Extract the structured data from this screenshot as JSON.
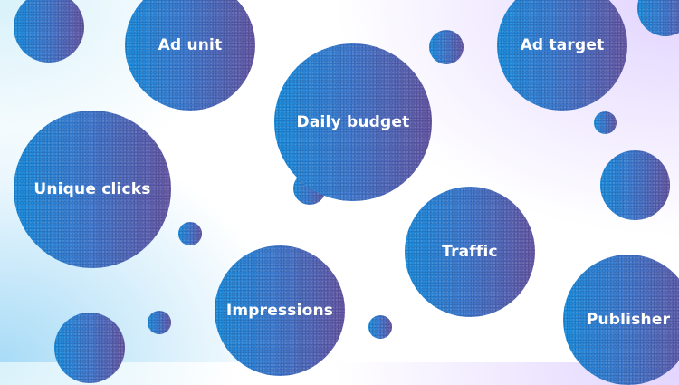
{
  "bubbles": {
    "ad_unit": "Ad unit",
    "ad_target": "Ad target",
    "daily_budget": "Daily budget",
    "unique_clicks": "Unique clicks",
    "traffic": "Traffic",
    "impressions": "Impressions",
    "publisher": "Publisher"
  },
  "colors": {
    "bubble_left": "#1b93e4",
    "bubble_right": "#6a5aa8",
    "background": "#ffffff",
    "glow_blue": "#60bef0",
    "glow_purple": "#bea0ff"
  }
}
